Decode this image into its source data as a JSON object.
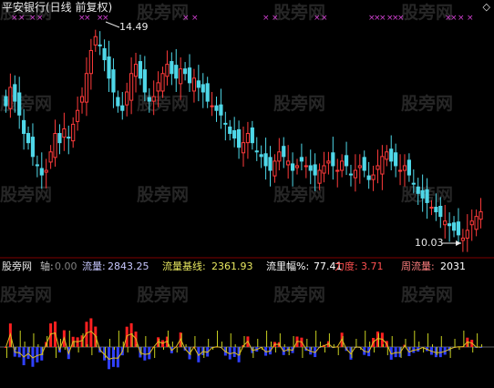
{
  "title": "平安银行(日线 前复权)",
  "annotations": {
    "high_label": "14.49",
    "low_label": "10.03"
  },
  "watermark": "股旁网",
  "indicator": {
    "name": "股旁网",
    "axis_label": "轴:",
    "axis_value": "0.00",
    "flow_label": "流量:",
    "flow_value": "2843.25",
    "base_label": "流量基线:",
    "base_value": "2361.93",
    "amp_label": "流里幅%:",
    "amp_value": "77.41",
    "force_label": "力度:",
    "force_value": "3.71",
    "weekly_label": "周流量:",
    "weekly_value": "2031"
  },
  "colors": {
    "up": "#ff3b3b",
    "down": "#4fd7e8",
    "marker": "#d040d0",
    "flow_pos": "#ff2020",
    "flow_neg": "#3040ff",
    "stem": "#c8d020",
    "line": "#e0c020"
  },
  "chart_data": {
    "type": "candlestick",
    "price_high": 14.49,
    "price_low": 10.03,
    "closes": [
      12.9,
      13.3,
      13.0,
      12.7,
      12.3,
      12.1,
      11.8,
      11.6,
      11.4,
      11.5,
      11.9,
      12.3,
      12.1,
      12.4,
      12.2,
      12.5,
      12.8,
      13.1,
      13.6,
      14.1,
      14.4,
      14.2,
      13.9,
      13.5,
      13.2,
      12.9,
      12.8,
      13.2,
      13.6,
      13.8,
      13.5,
      13.2,
      13.0,
      13.1,
      13.4,
      13.6,
      13.8,
      13.6,
      13.5,
      13.7,
      13.6,
      13.4,
      13.5,
      13.3,
      13.2,
      13.0,
      12.9,
      12.8,
      12.7,
      12.5,
      12.3,
      12.2,
      12.0,
      12.1,
      12.3,
      12.1,
      11.9,
      11.8,
      11.6,
      11.5,
      11.7,
      11.9,
      11.8,
      11.7,
      11.5,
      11.6,
      11.7,
      11.6,
      11.5,
      11.4,
      11.5,
      11.6,
      11.7,
      11.6,
      11.5,
      11.7,
      11.6,
      11.4,
      11.5,
      11.6,
      11.5,
      11.3,
      11.4,
      11.6,
      11.8,
      11.9,
      11.7,
      11.6,
      11.5,
      11.6,
      11.4,
      11.2,
      11.0,
      10.9,
      10.8,
      10.7,
      10.6,
      10.5,
      10.4,
      10.3,
      10.2,
      10.1,
      10.03,
      10.2,
      10.4,
      10.5,
      10.6
    ],
    "markers_top": "row of magenta x markers along the top edge"
  }
}
